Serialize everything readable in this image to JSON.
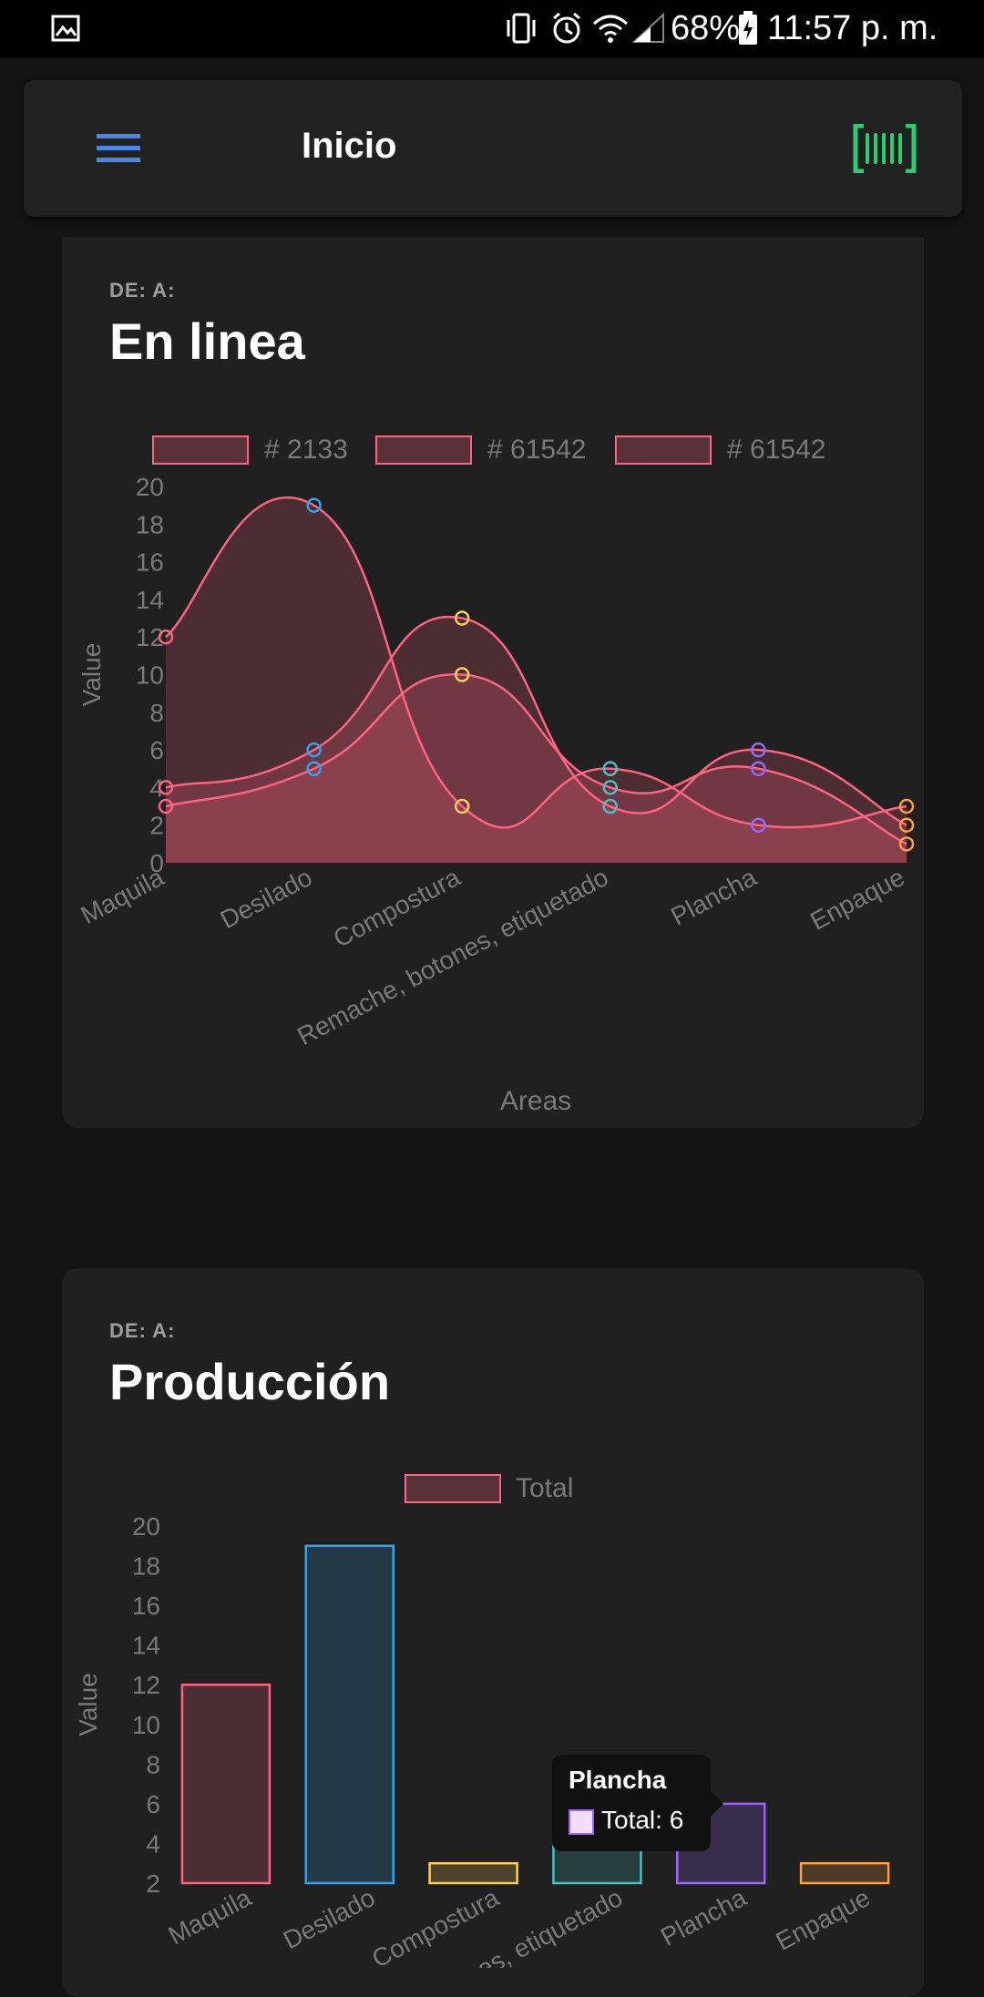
{
  "status_bar": {
    "battery": "68%",
    "time": "11:57 p. m."
  },
  "app_bar": {
    "title": "Inicio",
    "menu_icon": "hamburger-menu-icon",
    "scan_icon": "barcode-scan-icon",
    "colors": {
      "menu": "#4a86e8",
      "scan": "#2ecc71"
    }
  },
  "cards": [
    {
      "range_label": "DE: A:",
      "title": "En linea",
      "chart_data": {
        "type": "area",
        "curve": "smooth",
        "categories": [
          "Maquila",
          "Desilado",
          "Compostura",
          "Remache, botones, etiquetado",
          "Plancha",
          "Enpaque"
        ],
        "series": [
          {
            "name": "# 2133",
            "values": [
              12,
              19,
              3,
              5,
              2,
              3
            ]
          },
          {
            "name": "# 61542",
            "values": [
              4,
              6,
              13,
              3,
              6,
              2
            ]
          },
          {
            "name": "# 61542",
            "values": [
              3,
              5,
              10,
              4,
              5,
              1
            ]
          }
        ],
        "point_colors": [
          "#ff6384",
          "#36a2eb",
          "#ffce56",
          "#4bc0c0",
          "#9966ff",
          "#ff9f40"
        ],
        "ylabel": "Value",
        "xlabel": "Areas",
        "ylim": [
          0,
          20
        ],
        "yticks": [
          "20",
          "18",
          "16",
          "14",
          "12",
          "10",
          "8",
          "6",
          "4",
          "2",
          "0"
        ],
        "legend_position": "top",
        "line_color": "#ff6384",
        "fill_color": "#ff6384"
      }
    },
    {
      "range_label": "DE: A:",
      "title": "Producción",
      "chart_data": {
        "type": "bar",
        "categories": [
          "Maquila",
          "Desilado",
          "Compostura",
          "Remache, botones, etiquetado",
          "Plancha",
          "Enpaque"
        ],
        "series": [
          {
            "name": "Total",
            "values": [
              12,
              19,
              3,
              5,
              6,
              3
            ]
          }
        ],
        "bar_border_colors": [
          "#ff6384",
          "#36a2eb",
          "#ffce56",
          "#4bc0c0",
          "#9966ff",
          "#ff9f40"
        ],
        "ylabel": "Value",
        "ylim": [
          2,
          20
        ],
        "yticks": [
          "20",
          "18",
          "16",
          "14",
          "12",
          "10",
          "8",
          "6",
          "4",
          "2"
        ],
        "legend_position": "top"
      },
      "tooltip": {
        "title": "Plancha",
        "body": "Total: 6"
      }
    }
  ]
}
